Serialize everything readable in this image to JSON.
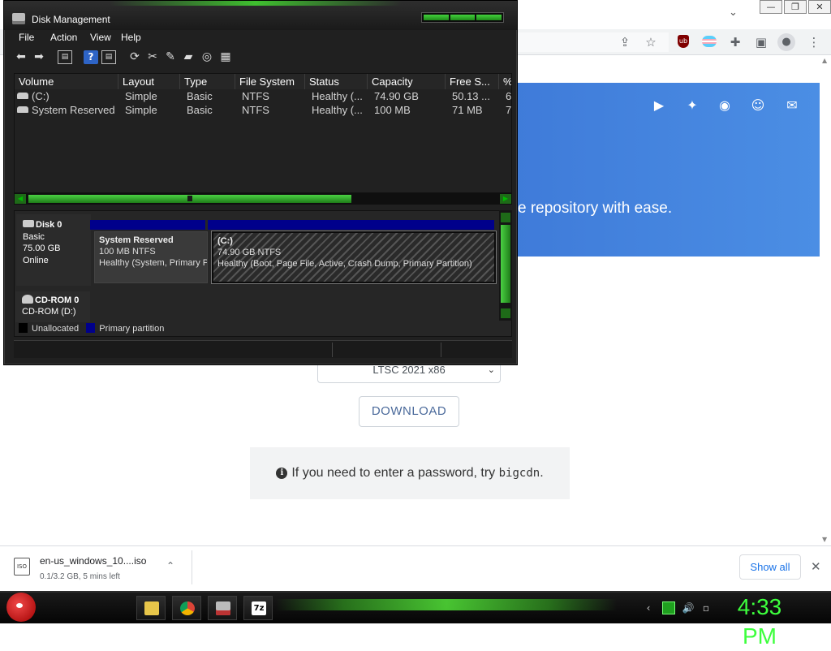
{
  "browser": {
    "window_controls": {
      "minimize": "—",
      "restore": "❐",
      "close": "✕"
    },
    "hero_text": "e repository with ease.",
    "social_icons": [
      "youtube-icon",
      "twitter-icon",
      "github-icon",
      "discord-icon",
      "mail-icon"
    ],
    "version_select": {
      "value": "LTSC 2021 x86"
    },
    "download_label": "DOWNLOAD",
    "notice": {
      "prefix": "If you need to enter a password, try ",
      "code": "bigcdn",
      "suffix": "."
    },
    "download_shelf": {
      "file_name": "en-us_windows_10....iso",
      "status": "0.1/3.2 GB, 5 mins left",
      "file_icon_text": "ISO",
      "show_all": "Show all"
    }
  },
  "disk_management": {
    "title": "Disk Management",
    "menu": [
      "File",
      "Action",
      "View",
      "Help"
    ],
    "columns": [
      "Volume",
      "Layout",
      "Type",
      "File System",
      "Status",
      "Capacity",
      "Free S...",
      "%"
    ],
    "volumes": [
      [
        "(C:)",
        "Simple",
        "Basic",
        "NTFS",
        "Healthy (...",
        "74.90 GB",
        "50.13 ...",
        "6"
      ],
      [
        "System Reserved",
        "Simple",
        "Basic",
        "NTFS",
        "Healthy (...",
        "100 MB",
        "71 MB",
        "7"
      ]
    ],
    "disk0": {
      "name": "Disk 0",
      "type": "Basic",
      "size": "75.00 GB",
      "state": "Online"
    },
    "partitions": [
      {
        "name": "System Reserved",
        "size": "100 MB NTFS",
        "status": "Healthy (System, Primary P"
      },
      {
        "name": "(C:)",
        "size": "74.90 GB NTFS",
        "status": "Healthy (Boot, Page File, Active, Crash Dump, Primary Partition)"
      }
    ],
    "cdrom": {
      "name": "CD-ROM 0",
      "drive": "CD-ROM (D:)"
    },
    "legend": [
      {
        "label": "Unallocated",
        "color": "#000000"
      },
      {
        "label": "Primary partition",
        "color": "#00008b"
      }
    ]
  },
  "taskbar": {
    "clock": "4:33 PM",
    "apps": [
      "file-explorer",
      "chrome",
      "disk-management",
      "7zip"
    ],
    "app_7z_label": "7z"
  },
  "colors": {
    "accent_green": "#3dff3d",
    "hero_blue": "#4b8ee4",
    "partition_blue": "#00008b"
  }
}
